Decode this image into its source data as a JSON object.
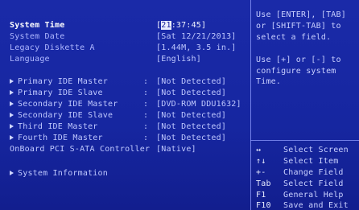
{
  "main": {
    "system_time": {
      "label": "System Time",
      "value_prefix": "[",
      "hour": "21",
      "value_rest": ":37:45]"
    },
    "system_date": {
      "label": "System Date",
      "value": "[Sat 12/21/2013]"
    },
    "legacy_diskette": {
      "label": "Legacy Diskette A",
      "value": "[1.44M, 3.5 in.]"
    },
    "language": {
      "label": "Language",
      "value": "[English]"
    },
    "ide_items": [
      {
        "label": "Primary IDE Master",
        "value": "[Not Detected]"
      },
      {
        "label": "Primary IDE Slave",
        "value": "[Not Detected]"
      },
      {
        "label": "Secondary IDE Master",
        "value": "[DVD-ROM DDU1632]"
      },
      {
        "label": "Secondary IDE Slave",
        "value": "[Not Detected]"
      },
      {
        "label": "Third IDE Master",
        "value": "[Not Detected]"
      },
      {
        "label": "Fourth IDE Master",
        "value": "[Not Detected]"
      }
    ],
    "colon": ":",
    "onboard_sata": {
      "label": "OnBoard PCI S-ATA Controller",
      "value": "[Native]"
    },
    "system_information": {
      "label": "System Information"
    }
  },
  "help": {
    "lines": [
      "Use [ENTER], [TAB]",
      "or [SHIFT-TAB] to",
      "select a field.",
      "",
      "Use [+] or [-] to",
      "configure system Time."
    ]
  },
  "keys": [
    {
      "key": "↔",
      "desc": "Select Screen"
    },
    {
      "key": "↑↓",
      "desc": "Select Item"
    },
    {
      "key": "+-",
      "desc": "Change Field"
    },
    {
      "key": "Tab",
      "desc": "Select Field"
    },
    {
      "key": "F1",
      "desc": "General Help"
    },
    {
      "key": "F10",
      "desc": "Save and Exit"
    }
  ],
  "colors": {
    "background": "#1626a0",
    "text": "#bfc8ff",
    "highlight": "#e8ecff",
    "frame": "#8f9cff"
  }
}
